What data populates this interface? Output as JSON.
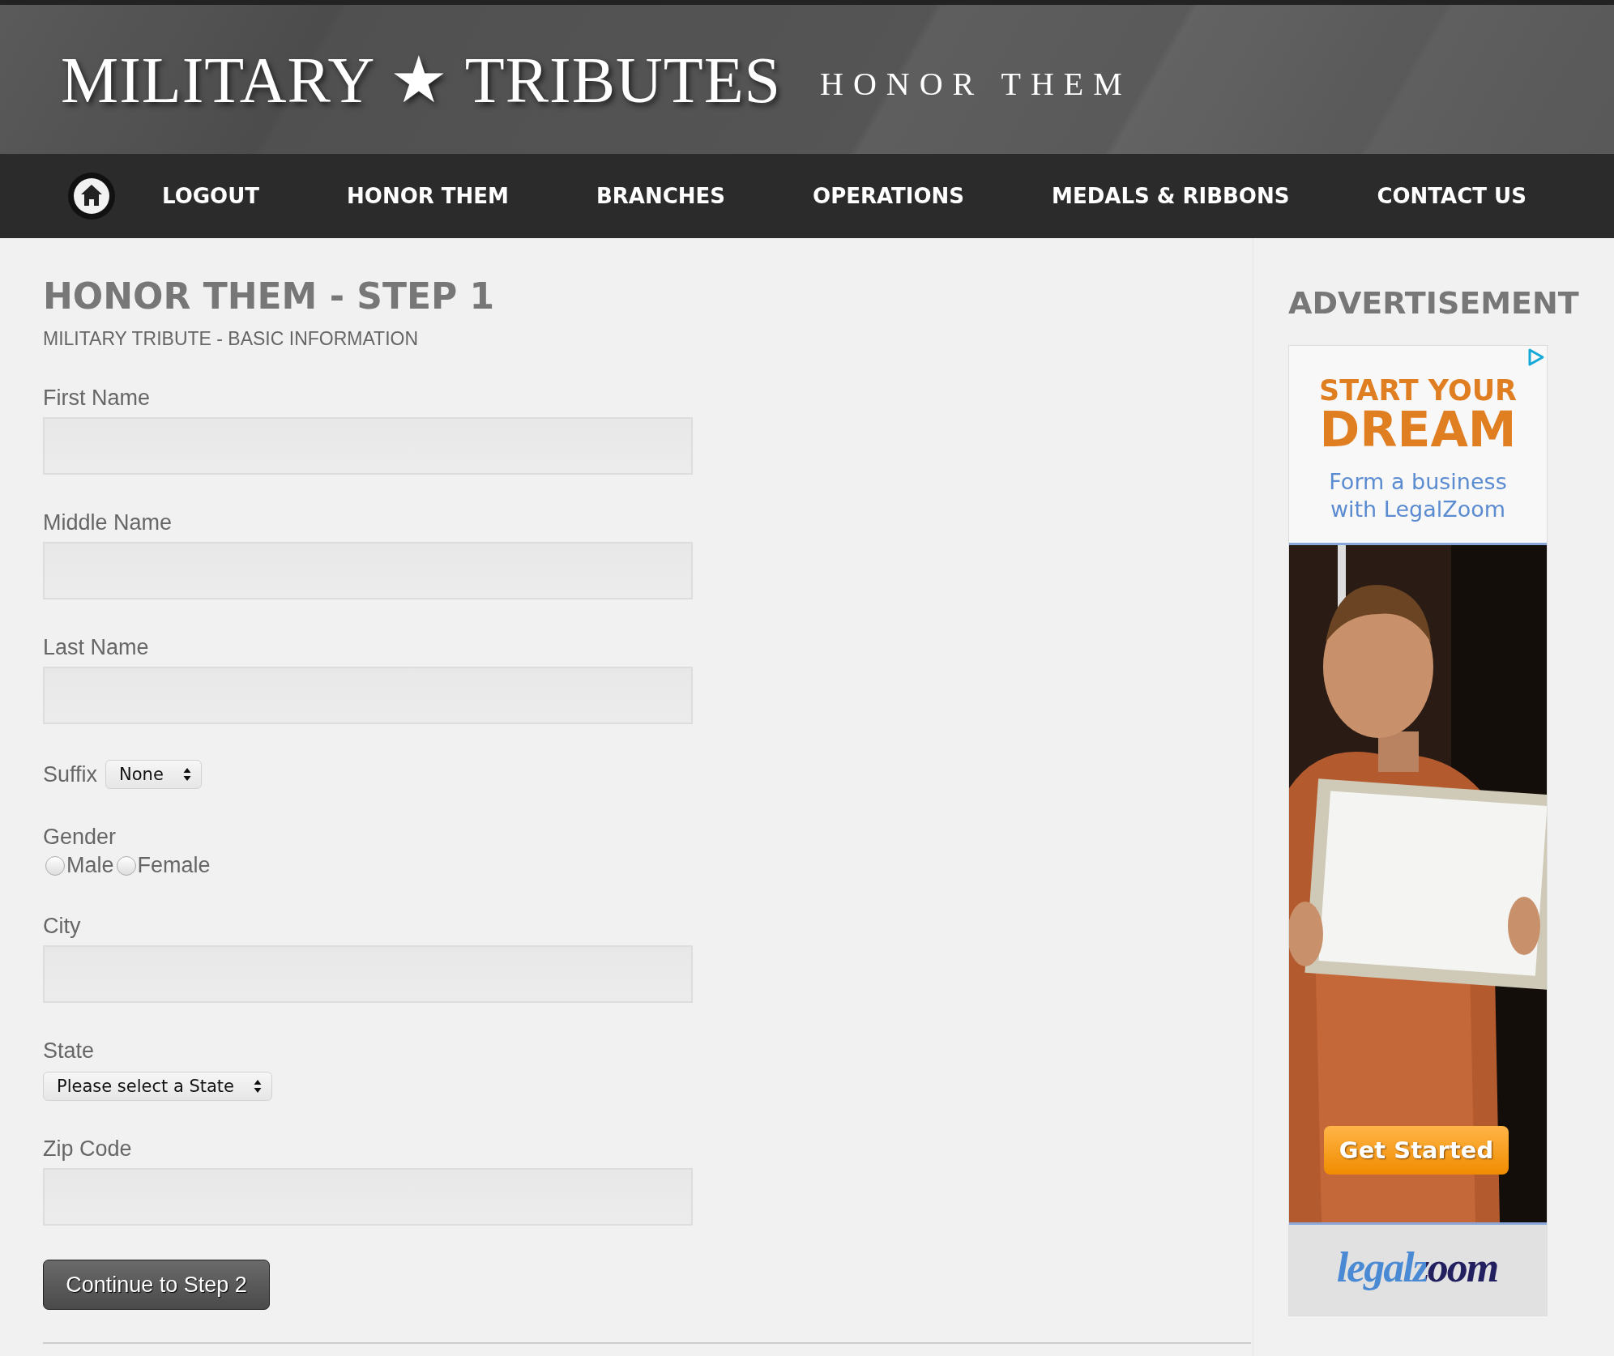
{
  "header": {
    "logo": "MILITARY ★ TRIBUTES",
    "tagline": "HONOR THEM"
  },
  "nav": {
    "items": [
      {
        "label": "LOGOUT"
      },
      {
        "label": "HONOR THEM"
      },
      {
        "label": "BRANCHES"
      },
      {
        "label": "OPERATIONS"
      },
      {
        "label": "MEDALS & RIBBONS"
      },
      {
        "label": "CONTACT US"
      }
    ]
  },
  "page": {
    "title": "HONOR THEM - STEP 1",
    "subtitle": "MILITARY TRIBUTE - BASIC INFORMATION"
  },
  "form": {
    "fields": [
      {
        "kind": "text",
        "label": "First Name"
      },
      {
        "kind": "text",
        "label": "Middle Name"
      },
      {
        "kind": "text",
        "label": "Last Name"
      },
      {
        "kind": "inline_select",
        "label": "Suffix",
        "value": "None"
      },
      {
        "kind": "radio",
        "label": "Gender",
        "options": [
          {
            "label": "Male",
            "selected": false
          },
          {
            "label": "Female",
            "selected": false
          }
        ]
      },
      {
        "kind": "text",
        "label": "City"
      },
      {
        "kind": "select",
        "label": "State",
        "value": "Please select a State"
      },
      {
        "kind": "text",
        "label": "Zip Code"
      }
    ],
    "submit": "Continue to Step 2"
  },
  "sidebar": {
    "heading": "ADVERTISEMENT",
    "ad": {
      "headline_small": "START YOUR",
      "headline_large": "DREAM",
      "tagline": "Form a business with LegalZoom",
      "button": "Get Started",
      "logo": "legalzoom"
    }
  }
}
